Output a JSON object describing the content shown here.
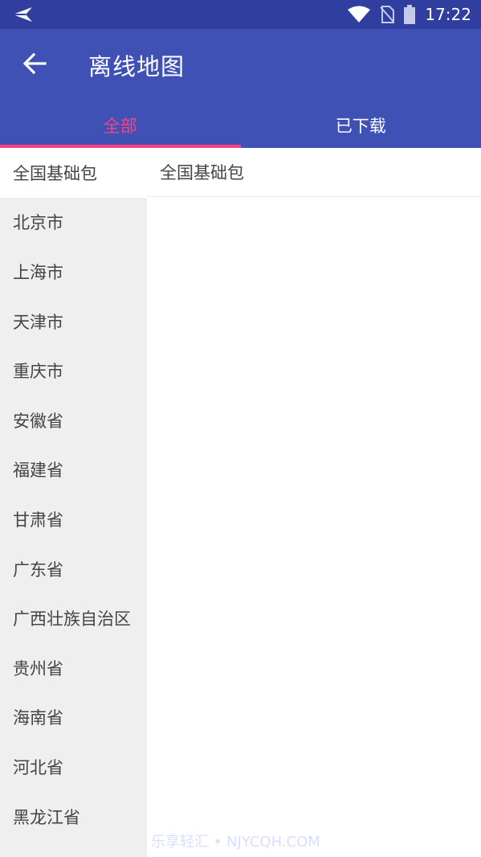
{
  "status_bar": {
    "time": "17:22",
    "icons": [
      "send-arrow-icon",
      "wifi-icon",
      "no-sim-icon",
      "battery-icon"
    ]
  },
  "app_bar": {
    "title": "离线地图",
    "back_icon": "arrow-back-icon",
    "color": "#3f51b5"
  },
  "tabs": [
    {
      "label": "全部",
      "active": true
    },
    {
      "label": "已下载",
      "active": false
    }
  ],
  "accent_color": "#ff4081",
  "provinces": [
    "全国基础包",
    "北京市",
    "上海市",
    "天津市",
    "重庆市",
    "安徽省",
    "福建省",
    "甘肃省",
    "广东省",
    "广西壮族自治区",
    "贵州省",
    "海南省",
    "河北省",
    "黑龙江省"
  ],
  "selected_province_index": 0,
  "detail": {
    "items": [
      "全国基础包"
    ]
  },
  "watermark": "乐享轻汇 • NJYCQH.COM"
}
